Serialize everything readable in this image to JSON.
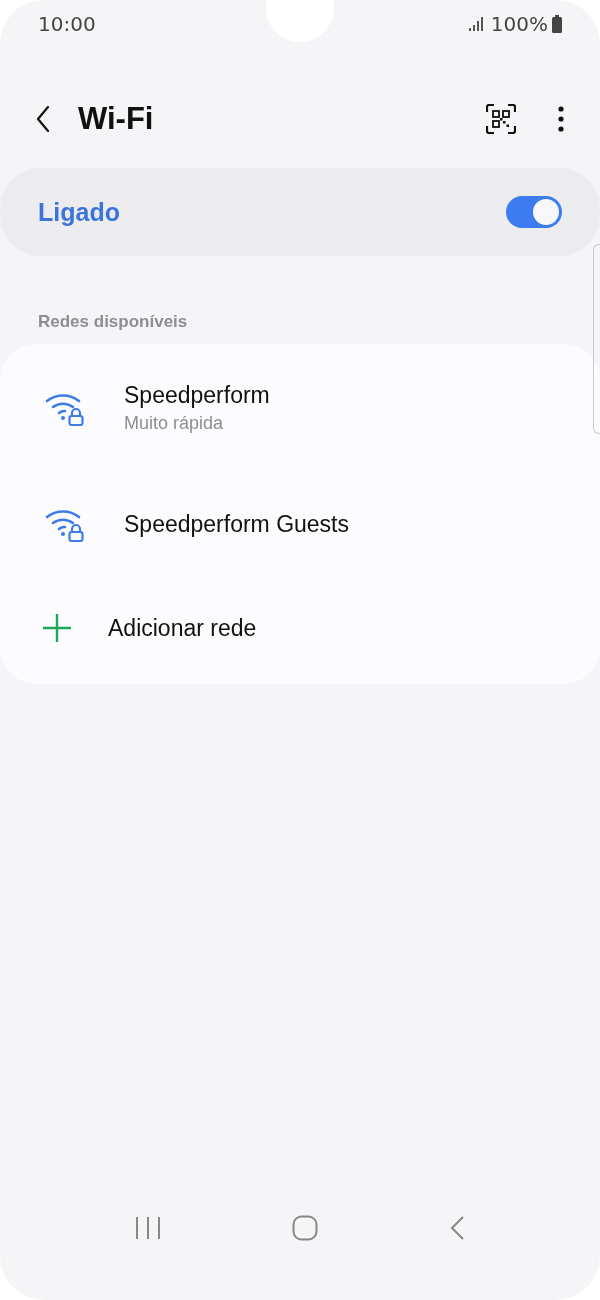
{
  "status_bar": {
    "time": "10:00",
    "battery": "100%"
  },
  "header": {
    "title": "Wi-Fi"
  },
  "master_switch": {
    "label": "Ligado",
    "on": true
  },
  "section": {
    "title": "Redes disponíveis"
  },
  "networks": [
    {
      "kind": "network",
      "name": "Speedperform",
      "subtitle": "Muito rápida"
    },
    {
      "kind": "network",
      "name": "Speedperform Guests"
    },
    {
      "kind": "add",
      "name": "Adicionar rede"
    }
  ]
}
